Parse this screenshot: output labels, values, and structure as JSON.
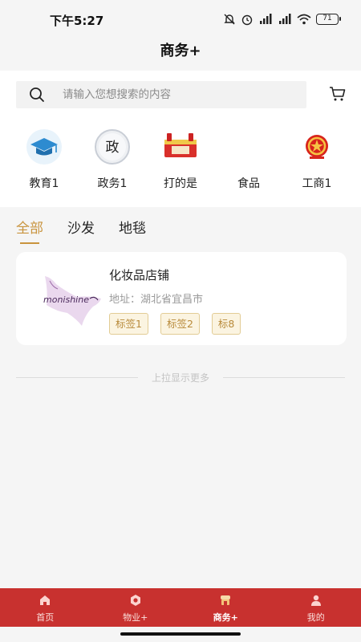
{
  "status_bar": {
    "time": "下午5:27",
    "battery": "71"
  },
  "nav": {
    "title": "商务+"
  },
  "search": {
    "placeholder": "请输入您想搜索的内容"
  },
  "categories": [
    {
      "label": "教育1",
      "icon": "graduation-cap-icon"
    },
    {
      "label": "政务1",
      "icon": "government-seal-icon"
    },
    {
      "label": "打的是",
      "icon": "product-box-icon"
    },
    {
      "label": "食品",
      "icon": "blank-icon"
    },
    {
      "label": "工商1",
      "icon": "national-emblem-icon"
    }
  ],
  "filter_tabs": [
    {
      "label": "全部",
      "active": true
    },
    {
      "label": "沙发",
      "active": false
    },
    {
      "label": "地毯",
      "active": false
    }
  ],
  "shops": [
    {
      "name": "化妆品店铺",
      "address": "地址：湖北省宜昌市",
      "logo_text": "monishine",
      "tags": [
        "标签1",
        "标签2",
        "标8"
      ]
    }
  ],
  "load_more": "上拉显示更多",
  "tabbar": [
    {
      "label": "首页",
      "icon": "home-icon",
      "active": false
    },
    {
      "label": "物业+",
      "icon": "property-icon",
      "active": false
    },
    {
      "label": "商务+",
      "icon": "business-icon",
      "active": true
    },
    {
      "label": "我的",
      "icon": "user-icon",
      "active": false
    }
  ],
  "colors": {
    "accent": "#c9943e",
    "tabbar_bg": "#c8312f",
    "tag_bg": "#fbf4e1"
  }
}
